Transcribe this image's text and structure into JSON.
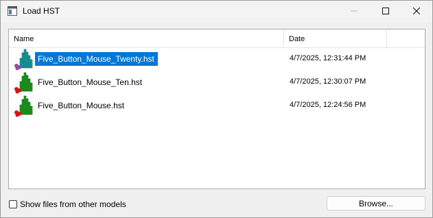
{
  "window": {
    "title": "Load HST",
    "icon": "app-window-icon",
    "controls": {
      "minimize": "minimize-icon",
      "maximize": "maximize-icon",
      "close": "close-icon"
    }
  },
  "file_list": {
    "columns": {
      "name": "Name",
      "date": "Date"
    },
    "rows": [
      {
        "name": "Five_Button_Mouse_Twenty.hst",
        "date": "4/7/2025, 12:31:44 PM",
        "selected": true,
        "icon": "histogram-file-icon",
        "icon_colors": {
          "bars": "#1a9aa0",
          "dots": "#8e4fa0"
        }
      },
      {
        "name": "Five_Button_Mouse_Ten.hst",
        "date": "4/7/2025, 12:30:07 PM",
        "selected": false,
        "icon": "histogram-file-icon",
        "icon_colors": {
          "bars": "#1f9e1f",
          "dots": "#e01010"
        }
      },
      {
        "name": "Five_Button_Mouse.hst",
        "date": "4/7/2025, 12:24:56 PM",
        "selected": false,
        "icon": "histogram-file-icon",
        "icon_colors": {
          "bars": "#1f9e1f",
          "dots": "#e01010"
        }
      }
    ]
  },
  "footer": {
    "show_other_models_label": "Show files from other models",
    "show_other_models_checked": false,
    "browse_label": "Browse..."
  },
  "colors": {
    "selection": "#0078d7",
    "window_bg": "#f0f0f0"
  }
}
